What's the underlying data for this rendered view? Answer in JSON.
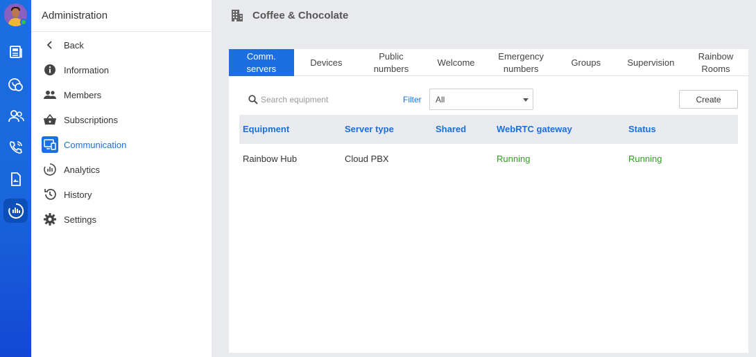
{
  "panel": {
    "title": "Administration",
    "nav": [
      {
        "label": "Back",
        "icon": "chevron-left-icon"
      },
      {
        "label": "Information",
        "icon": "info-icon"
      },
      {
        "label": "Members",
        "icon": "members-icon"
      },
      {
        "label": "Subscriptions",
        "icon": "basket-icon"
      },
      {
        "label": "Communication",
        "icon": "communication-icon",
        "active": true
      },
      {
        "label": "Analytics",
        "icon": "analytics-icon"
      },
      {
        "label": "History",
        "icon": "history-icon"
      },
      {
        "label": "Settings",
        "icon": "gear-icon"
      }
    ]
  },
  "rail": {
    "icons": [
      "news-icon",
      "phone-chat-icon",
      "contacts-icon",
      "calls-icon",
      "files-icon",
      "admin-analytics-icon"
    ],
    "active": "admin-analytics-icon"
  },
  "company": {
    "name": "Coffee & Chocolate",
    "icon": "building-icon"
  },
  "tabs": [
    {
      "line1": "Comm.",
      "line2": "servers",
      "active": true
    },
    {
      "line1": "Devices",
      "line2": ""
    },
    {
      "line1": "Public",
      "line2": "numbers"
    },
    {
      "line1": "Welcome",
      "line2": ""
    },
    {
      "line1": "Emergency",
      "line2": "numbers"
    },
    {
      "line1": "Groups",
      "line2": ""
    },
    {
      "line1": "Supervision",
      "line2": ""
    },
    {
      "line1": "Rainbow",
      "line2": "Rooms"
    }
  ],
  "toolbar": {
    "search_placeholder": "Search equipment",
    "filter_label": "Filter",
    "filter_value": "All",
    "create_label": "Create"
  },
  "table": {
    "columns": [
      "Equipment",
      "Server type",
      "Shared",
      "WebRTC gateway",
      "Status"
    ],
    "rows": [
      {
        "equipment": "Rainbow Hub",
        "server_type": "Cloud PBX",
        "shared": "",
        "webrtc": "Running",
        "status": "Running"
      }
    ]
  },
  "colors": {
    "accent": "#1b6fe0",
    "running": "#2e9e1e",
    "rail": "#1a66dc"
  }
}
